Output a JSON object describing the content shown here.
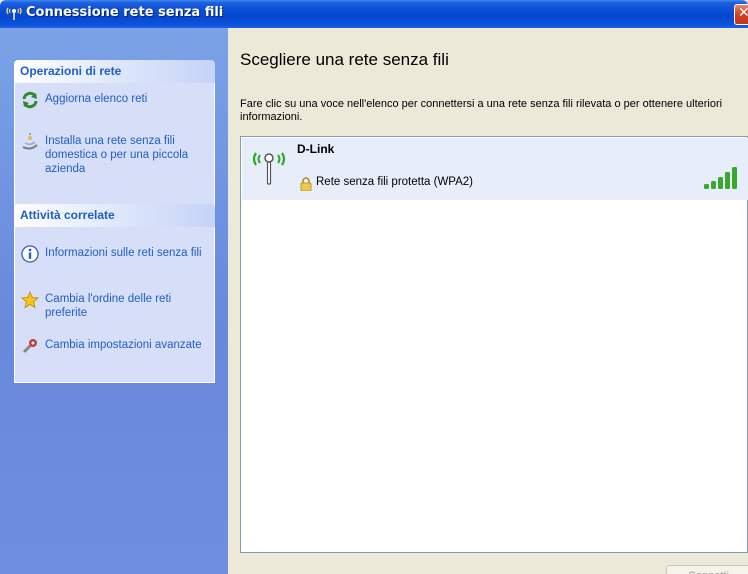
{
  "window": {
    "title": "Connessione rete senza fili"
  },
  "sidebar": {
    "panels": [
      {
        "header": "Operazioni di rete",
        "items": [
          {
            "label": "Aggiorna elenco reti",
            "icon": "refresh-icon"
          },
          {
            "label": "Installa una rete senza fili domestica o per una piccola azienda",
            "icon": "setup-wizard-icon"
          }
        ]
      },
      {
        "header": "Attività correlate",
        "items": [
          {
            "label": "Informazioni sulle reti senza fili",
            "icon": "info-icon"
          },
          {
            "label": "Cambia l'ordine delle reti preferite",
            "icon": "star-icon"
          },
          {
            "label": "Cambia impostazioni avanzate",
            "icon": "settings-icon"
          }
        ]
      }
    ]
  },
  "main": {
    "heading": "Scegliere una rete senza fili",
    "instructions": "Fare clic su una voce nell'elenco per connettersi a una rete senza fili rilevata o per ottenere ulteriori informazioni.",
    "networks": [
      {
        "name": "D-Link",
        "security": "Rete senza fili protetta (WPA2)",
        "signal_bars": 5,
        "selected": true
      }
    ],
    "connect_label": "Connetti",
    "connect_enabled": false
  },
  "colors": {
    "titlebar": "#0a4fd6",
    "taskpane": "#6f8ee0",
    "link": "#215dc6",
    "signal": "#3aa82c"
  }
}
